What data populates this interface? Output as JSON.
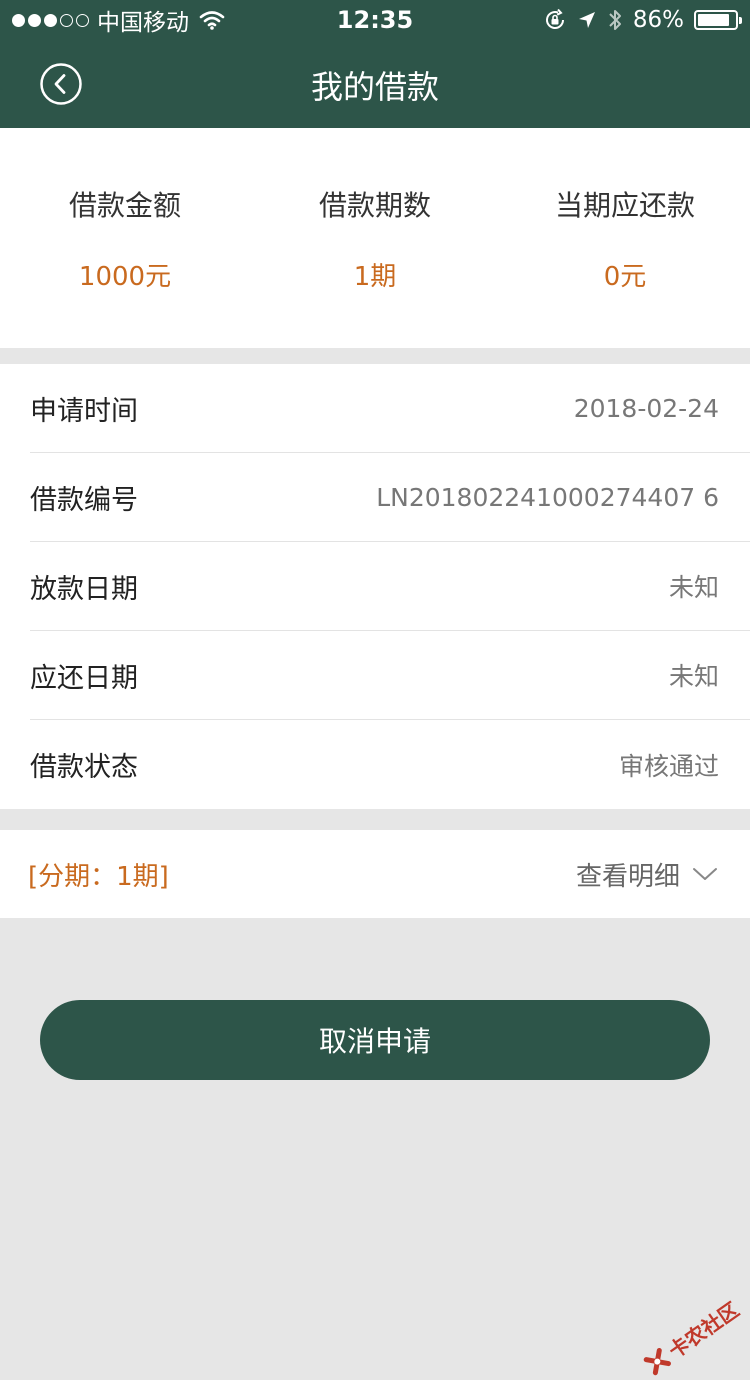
{
  "status_bar": {
    "carrier": "中国移动",
    "time": "12:35",
    "battery": "86%",
    "battery_level": 0.86
  },
  "nav": {
    "title": "我的借款",
    "back_icon": "chevron-left-circle-icon"
  },
  "summary": [
    {
      "label": "借款金额",
      "value": "1000元"
    },
    {
      "label": "借款期数",
      "value": "1期"
    },
    {
      "label": "当期应还款",
      "value": "0元"
    }
  ],
  "details": [
    {
      "label": "申请时间",
      "value": "2018-02-24"
    },
    {
      "label": "借款编号",
      "value": "LN201802241000274407 6"
    },
    {
      "label": "放款日期",
      "value": "未知"
    },
    {
      "label": "应还日期",
      "value": "未知"
    },
    {
      "label": "借款状态",
      "value": "审核通过"
    }
  ],
  "installment": {
    "label": "[分期：1期]",
    "link": "查看明细"
  },
  "actions": {
    "cancel_label": "取消申请"
  },
  "watermark": {
    "text": "卡农社区"
  },
  "colors": {
    "brand": "#2d5549",
    "accent": "#c96a1f"
  }
}
